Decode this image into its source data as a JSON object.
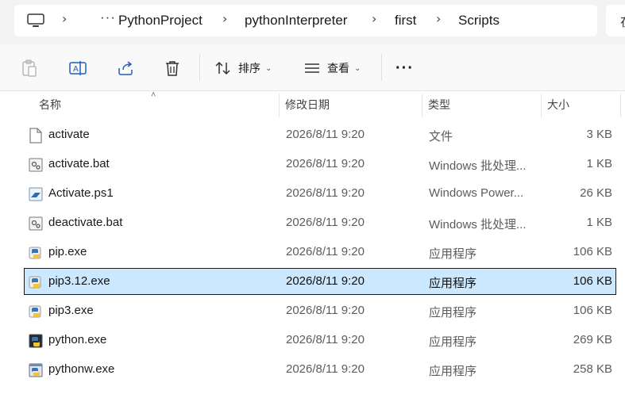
{
  "breadcrumb": {
    "overflow": "···",
    "items": [
      "PythonProject",
      "pythonInterpreter",
      "first",
      "Scripts"
    ],
    "search_stub": "在"
  },
  "toolbar": {
    "sort_label": "排序",
    "view_label": "查看",
    "more_label": "···"
  },
  "columns": {
    "name": "名称",
    "date": "修改日期",
    "type": "类型",
    "size": "大小"
  },
  "files": [
    {
      "name": "activate",
      "date": "2026/8/11 9:20",
      "type": "文件",
      "size": "3 KB",
      "icon": "blank-file-icon"
    },
    {
      "name": "activate.bat",
      "date": "2026/8/11 9:20",
      "type": "Windows 批处理...",
      "size": "1 KB",
      "icon": "batch-file-icon"
    },
    {
      "name": "Activate.ps1",
      "date": "2026/8/11 9:20",
      "type": "Windows Power...",
      "size": "26 KB",
      "icon": "powershell-file-icon"
    },
    {
      "name": "deactivate.bat",
      "date": "2026/8/11 9:20",
      "type": "Windows 批处理...",
      "size": "1 KB",
      "icon": "batch-file-icon"
    },
    {
      "name": "pip.exe",
      "date": "2026/8/11 9:20",
      "type": "应用程序",
      "size": "106 KB",
      "icon": "python-exe-icon"
    },
    {
      "name": "pip3.12.exe",
      "date": "2026/8/11 9:20",
      "type": "应用程序",
      "size": "106 KB",
      "icon": "python-exe-icon",
      "selected": true
    },
    {
      "name": "pip3.exe",
      "date": "2026/8/11 9:20",
      "type": "应用程序",
      "size": "106 KB",
      "icon": "python-exe-icon"
    },
    {
      "name": "python.exe",
      "date": "2026/8/11 9:20",
      "type": "应用程序",
      "size": "269 KB",
      "icon": "python-console-icon"
    },
    {
      "name": "pythonw.exe",
      "date": "2026/8/11 9:20",
      "type": "应用程序",
      "size": "258 KB",
      "icon": "python-window-icon"
    }
  ],
  "colors": {
    "selection_bg": "#cce8ff",
    "toolbar_bg": "#f9f9f9",
    "chrome_bg": "#f3f3f3"
  }
}
